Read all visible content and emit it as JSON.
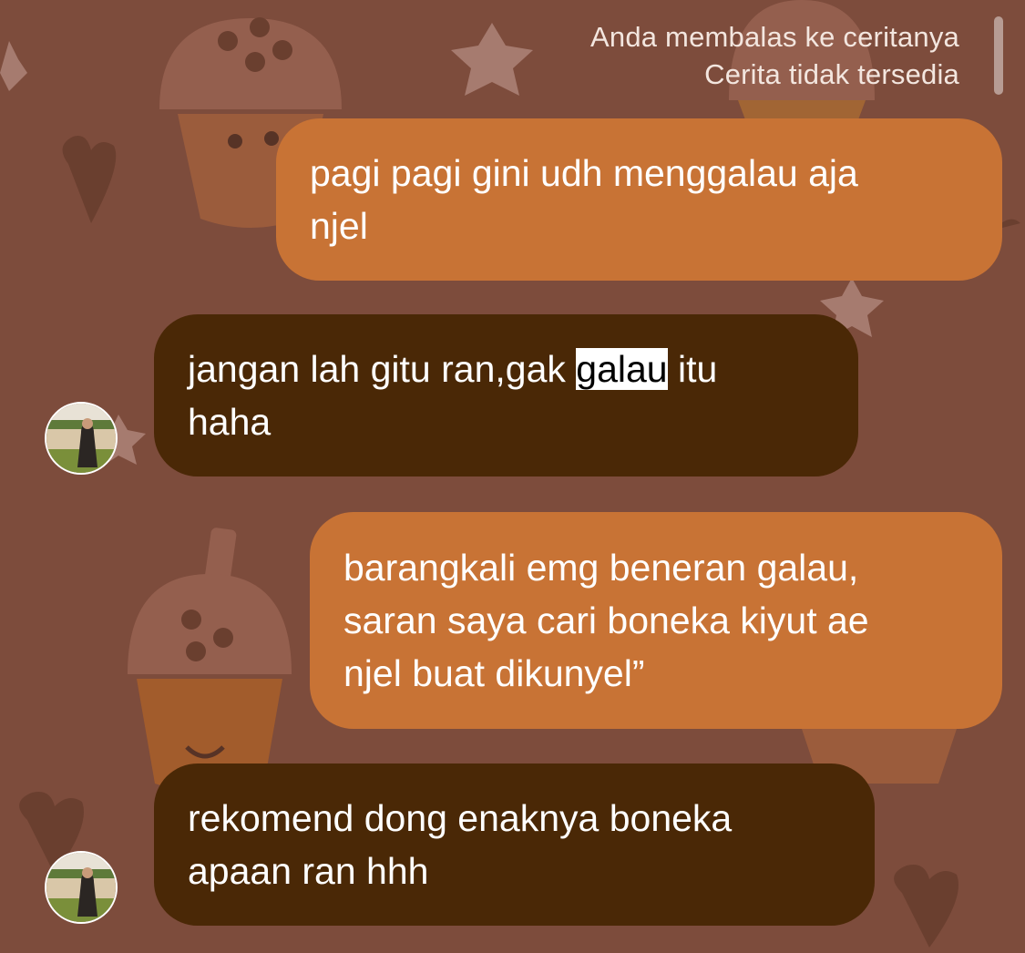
{
  "reply_note": {
    "line1": "Anda membalas ke ceritanya",
    "line2": "Cerita tidak tersedia"
  },
  "messages": [
    {
      "direction": "outgoing",
      "text": "pagi pagi gini udh menggalau aja\nnjel"
    },
    {
      "direction": "incoming",
      "before": "jangan lah gitu ran,gak ",
      "highlight": "galau",
      "after": " itu\nhaha"
    },
    {
      "direction": "outgoing",
      "text": "barangkali emg beneran galau,\nsaran saya cari boneka kiyut ae\nnjel buat dikunyel”"
    },
    {
      "direction": "incoming",
      "text": "rekomend dong enaknya boneka\napaan ran hhh"
    }
  ],
  "colors": {
    "background": "#7d4c3c",
    "outgoing_bubble": "#c87335",
    "incoming_bubble": "#4a2806"
  }
}
